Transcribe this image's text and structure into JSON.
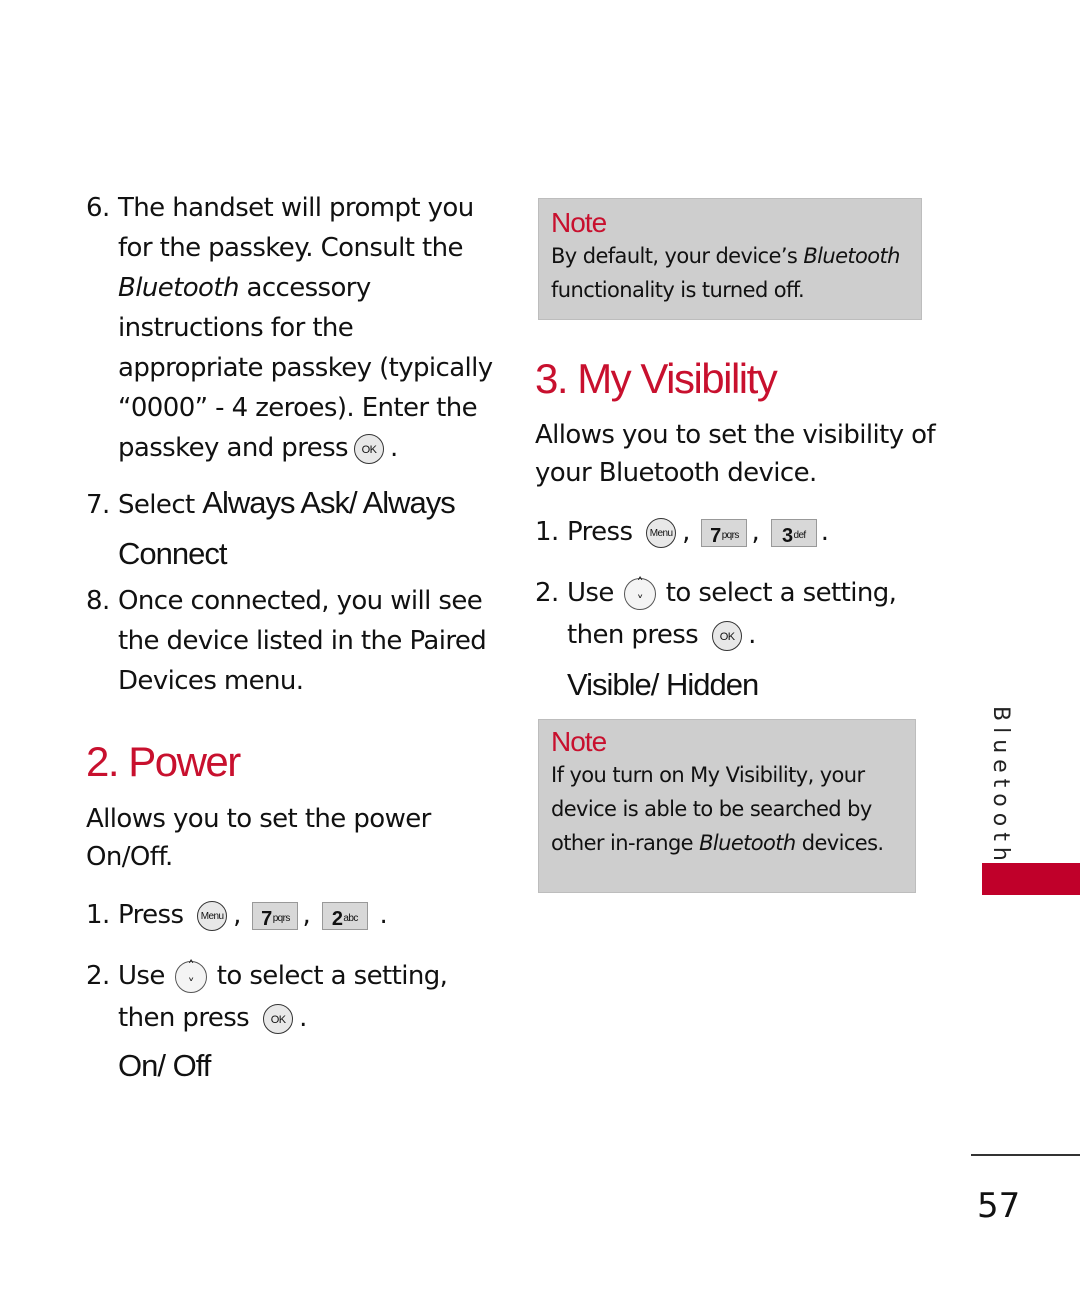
{
  "left_column": {
    "step6": {
      "number": "6.",
      "lines": [
        "The handset will prompt you",
        "for the passkey. Consult the"
      ],
      "italic_word": "Bluetooth",
      "after_italic": " accessory",
      "lines2": [
        "instructions for the",
        "appropriate passkey (typically",
        "“0000” - 4 zeroes). Enter the"
      ],
      "last_line": "passkey and press",
      "ok_key": "OK",
      "end": "."
    },
    "step7": {
      "number": "7.",
      "prefix": "Select ",
      "option_line1": "Always Ask/ Always",
      "option_line2": "Connect"
    },
    "step8": {
      "number": "8.",
      "lines": [
        "Once connected, you will see",
        "the device listed in the Paired",
        "Devices menu."
      ]
    },
    "power_section": {
      "heading": "2. Power",
      "description_lines": [
        "Allows you to set the power",
        "On/Off."
      ],
      "step1": {
        "number": "1.",
        "label": "Press",
        "menu_key": "Menu",
        "key2_digit": "7",
        "key2_letters": "pqrs",
        "key3_digit": "2",
        "key3_letters": "abc",
        "sep": ",",
        "end": "."
      },
      "step2": {
        "number": "2.",
        "use": "Use",
        "after_nav": "to select a setting,",
        "then_press": "then press",
        "ok_key": "OK",
        "end": "."
      },
      "options": "On/ Off"
    }
  },
  "right_column": {
    "note1": {
      "title": "Note",
      "line1_prefix": "By default, your device’s ",
      "line1_italic": "Bluetooth",
      "line2": "functionality is turned off."
    },
    "visibility_section": {
      "heading": "3. My Visibility",
      "description_lines": [
        "Allows you to set the visibility of",
        "your Bluetooth device."
      ],
      "step1": {
        "number": "1.",
        "label": "Press",
        "menu_key": "Menu",
        "key2_digit": "7",
        "key2_letters": "pqrs",
        "key3_digit": "3",
        "key3_letters": "def",
        "sep": ",",
        "end": "."
      },
      "step2": {
        "number": "2.",
        "use": "Use",
        "after_nav": "to select a setting,",
        "then_press": "then press",
        "ok_key": "OK",
        "end": "."
      },
      "options": "Visible/ Hidden"
    },
    "note2": {
      "title": "Note",
      "line1": "If you turn on My Visibility, your",
      "line2": "device is able to be searched by",
      "line3_prefix": "other in-range ",
      "line3_italic": "Bluetooth",
      "line3_suffix": " devices."
    }
  },
  "side_tab": {
    "label": "Bluetooth",
    "mark": "®",
    "accent_color": "#c0002a"
  },
  "footer": {
    "page_number": "57"
  },
  "colors": {
    "heading_red": "#c8102e",
    "note_bg": "#cecece"
  }
}
